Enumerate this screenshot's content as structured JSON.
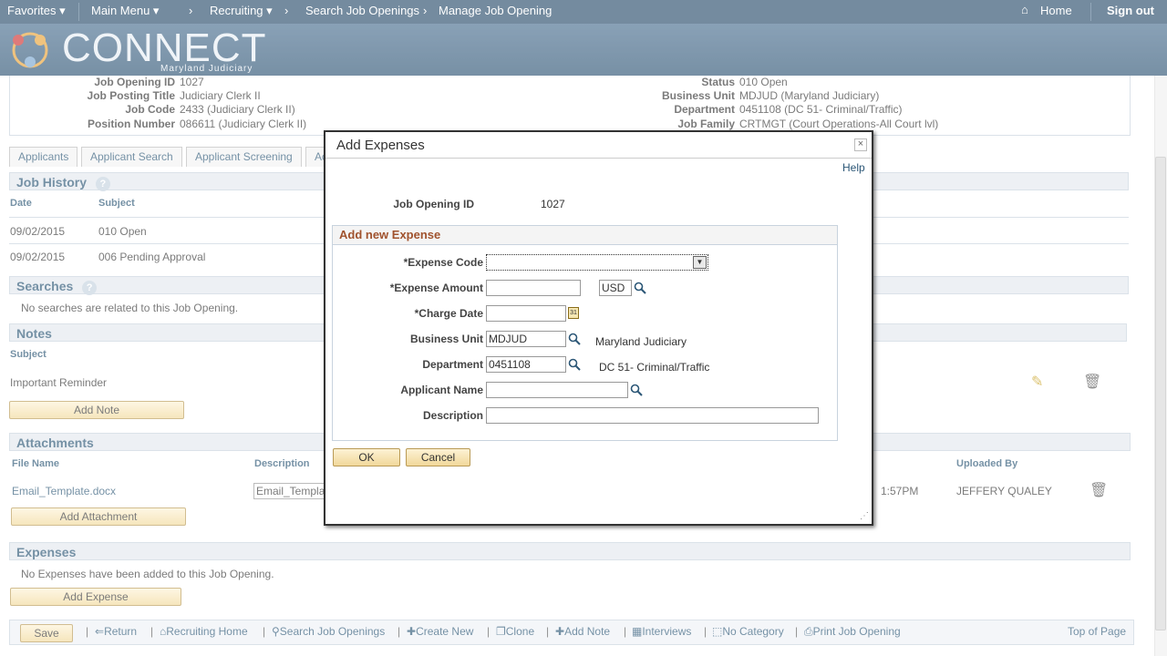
{
  "nav": {
    "favorites": "Favorites",
    "main_menu": "Main Menu",
    "crumbs": [
      "Recruiting",
      "Search Job Openings",
      "Manage Job Opening"
    ],
    "home": "Home",
    "signout": "Sign out"
  },
  "logo": {
    "title": "CONNECT",
    "subtitle": "Maryland Judiciary"
  },
  "header": {
    "job_opening_id_label": "Job Opening ID",
    "job_opening_id": "1027",
    "job_posting_title_label": "Job Posting Title",
    "job_posting_title": "Judiciary Clerk II",
    "job_code_label": "Job Code",
    "job_code": "2433 (Judiciary Clerk II)",
    "position_number_label": "Position Number",
    "position_number": "086611 (Judiciary Clerk II)",
    "status_label": "Status",
    "status": "010 Open",
    "business_unit_label": "Business Unit",
    "business_unit": "MDJUD (Maryland Judiciary)",
    "department_label": "Department",
    "department": "0451108 (DC 51- Criminal/Traffic)",
    "job_family_label": "Job Family",
    "job_family": "CRTMGT (Court Operations-All Court lvl)"
  },
  "tabs": [
    "Applicants",
    "Applicant Search",
    "Applicant Screening",
    "Ac"
  ],
  "job_history": {
    "title": "Job History",
    "col_date": "Date",
    "col_subject": "Subject",
    "rows": [
      {
        "date": "09/02/2015",
        "subject": "010 Open"
      },
      {
        "date": "09/02/2015",
        "subject": "006 Pending Approval"
      }
    ]
  },
  "searches": {
    "title": "Searches",
    "empty": "No searches are related to this Job Opening."
  },
  "notes": {
    "title": "Notes",
    "col_subject": "Subject",
    "row_subject": "Important Reminder",
    "add_button": "Add Note"
  },
  "attachments": {
    "title": "Attachments",
    "col_file": "File Name",
    "col_desc": "Description",
    "col_uploaded": "Uploaded By",
    "file": "Email_Template.docx",
    "desc": "Email_Templa",
    "time": "1:57PM",
    "uploaded_by": "JEFFERY QUALEY",
    "add_button": "Add Attachment"
  },
  "expenses": {
    "title": "Expenses",
    "empty": "No Expenses have been added to this Job Opening.",
    "add_button": "Add Expense"
  },
  "bottom": {
    "save": "Save",
    "return": "Return",
    "recruiting_home": "Recruiting Home",
    "search_job_openings": "Search Job Openings",
    "create_new": "Create New",
    "clone": "Clone",
    "add_note": "Add Note",
    "interviews": "Interviews",
    "no_category": "No Category",
    "print_job_opening": "Print Job Opening",
    "top_of_page": "Top of Page"
  },
  "modal": {
    "title": "Add Expenses",
    "help": "Help",
    "job_opening_id_label": "Job Opening ID",
    "job_opening_id": "1027",
    "section_title": "Add new Expense",
    "expense_code_label": "*Expense Code",
    "expense_code": "",
    "expense_amount_label": "*Expense Amount",
    "expense_amount": "",
    "currency": "USD",
    "charge_date_label": "*Charge Date",
    "charge_date": "",
    "business_unit_label": "Business Unit",
    "business_unit": "MDJUD",
    "business_unit_desc": "Maryland Judiciary",
    "department_label": "Department",
    "department": "0451108",
    "department_desc": "DC 51- Criminal/Traffic",
    "applicant_name_label": "Applicant Name",
    "applicant_name": "",
    "description_label": "Description",
    "description": "",
    "ok": "OK",
    "cancel": "Cancel"
  },
  "colors": {
    "nav_bg": "#2a4e6c",
    "section_text": "#2b5676",
    "button_bg": "#f1d89a"
  }
}
